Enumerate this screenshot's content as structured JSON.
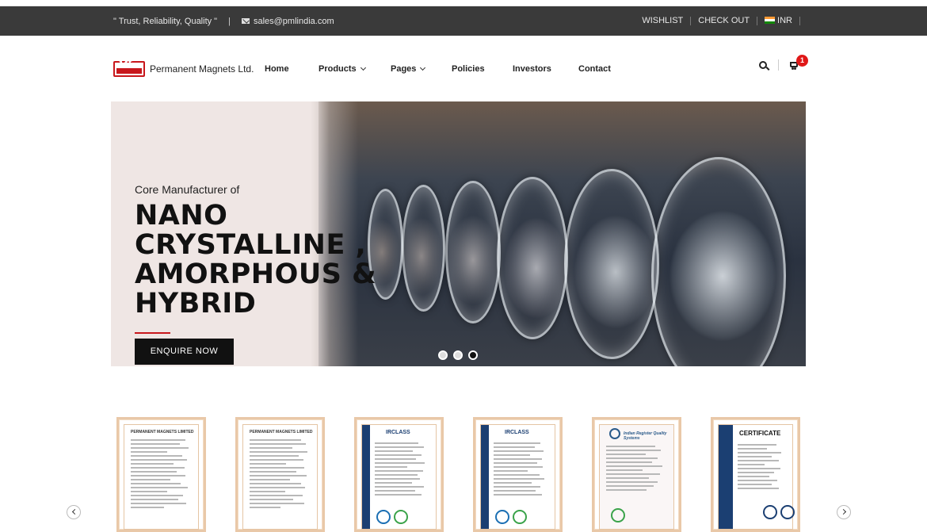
{
  "topbar": {
    "tagline": "\" Trust, Reliability, Quality \"",
    "divider": "|",
    "email": "sales@pmlindia.com",
    "wishlist": "WISHLIST",
    "checkout": "CHECK OUT",
    "currency": "INR"
  },
  "header": {
    "logo_initials": "ML",
    "logo_name": "Permanent Magnets Ltd.",
    "nav": [
      {
        "label": "Home"
      },
      {
        "label": "Products"
      },
      {
        "label": "Pages"
      },
      {
        "label": "Policies"
      },
      {
        "label": "Investors"
      },
      {
        "label": "Contact"
      }
    ],
    "cart_count": "1"
  },
  "hero": {
    "subtitle": "Core Manufacturer of",
    "title_lines": [
      "NANO",
      "CRYSTALLINE ,",
      "AMORPHOUS &",
      "HYBRID"
    ],
    "cta": "ENQUIRE NOW",
    "slides": 3,
    "active_slide": 3
  },
  "certificates": [
    {
      "heading": "PERMANENT MAGNETS LIMITED"
    },
    {
      "heading": "PERMANENT MAGNETS LIMITED"
    },
    {
      "heading": "IRCLASS"
    },
    {
      "heading": "IRCLASS"
    },
    {
      "heading": "Indian Register Quality Systems"
    },
    {
      "heading": "CERTIFICATE"
    }
  ],
  "colors": {
    "topbar_bg": "#3a3a3a",
    "brand_red": "#c8171c",
    "hero_panel": "#efe6e4",
    "cert_border": "#e9c8a8"
  }
}
